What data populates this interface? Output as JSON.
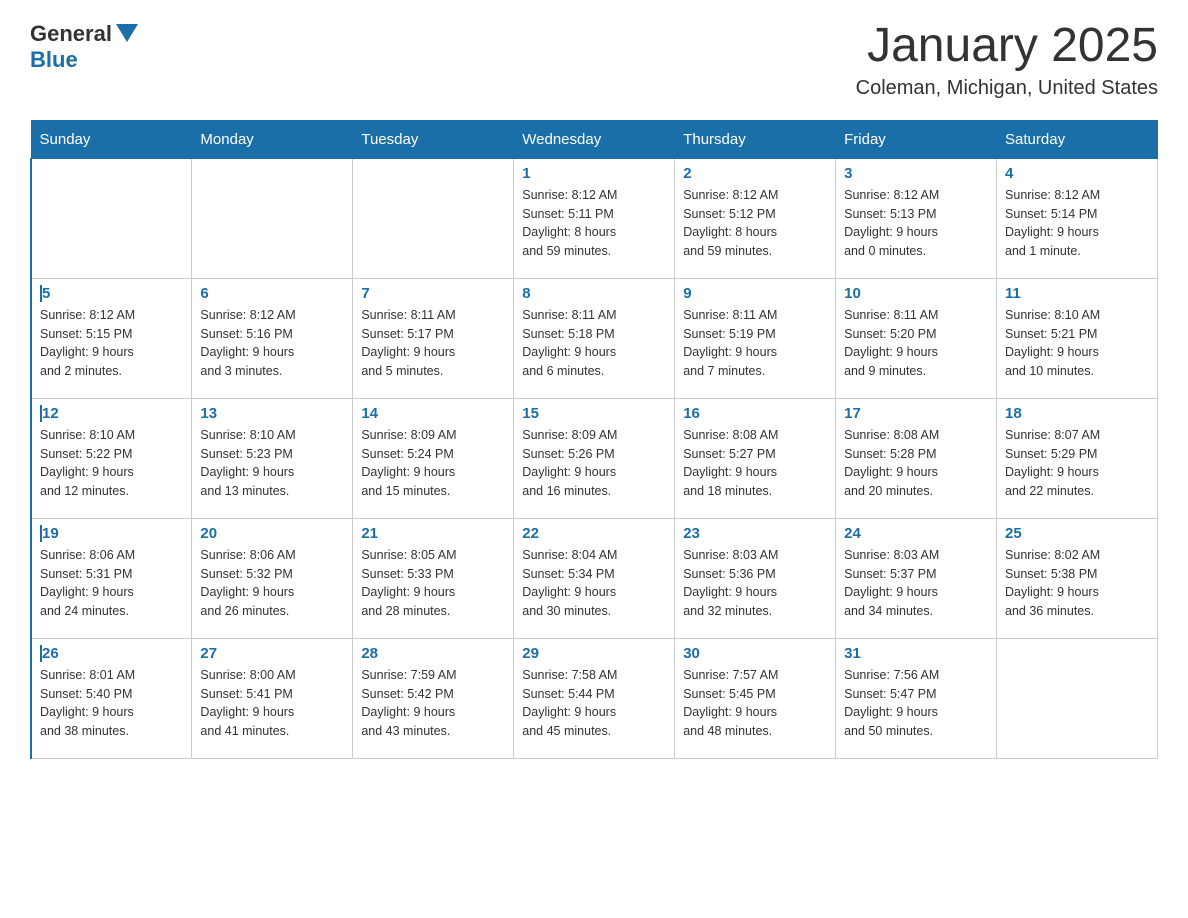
{
  "header": {
    "logo": {
      "general": "General",
      "arrow": "▶",
      "blue": "Blue"
    },
    "title": "January 2025",
    "location": "Coleman, Michigan, United States"
  },
  "weekdays": [
    "Sunday",
    "Monday",
    "Tuesday",
    "Wednesday",
    "Thursday",
    "Friday",
    "Saturday"
  ],
  "weeks": [
    [
      {
        "day": "",
        "info": ""
      },
      {
        "day": "",
        "info": ""
      },
      {
        "day": "",
        "info": ""
      },
      {
        "day": "1",
        "info": "Sunrise: 8:12 AM\nSunset: 5:11 PM\nDaylight: 8 hours\nand 59 minutes."
      },
      {
        "day": "2",
        "info": "Sunrise: 8:12 AM\nSunset: 5:12 PM\nDaylight: 8 hours\nand 59 minutes."
      },
      {
        "day": "3",
        "info": "Sunrise: 8:12 AM\nSunset: 5:13 PM\nDaylight: 9 hours\nand 0 minutes."
      },
      {
        "day": "4",
        "info": "Sunrise: 8:12 AM\nSunset: 5:14 PM\nDaylight: 9 hours\nand 1 minute."
      }
    ],
    [
      {
        "day": "5",
        "info": "Sunrise: 8:12 AM\nSunset: 5:15 PM\nDaylight: 9 hours\nand 2 minutes."
      },
      {
        "day": "6",
        "info": "Sunrise: 8:12 AM\nSunset: 5:16 PM\nDaylight: 9 hours\nand 3 minutes."
      },
      {
        "day": "7",
        "info": "Sunrise: 8:11 AM\nSunset: 5:17 PM\nDaylight: 9 hours\nand 5 minutes."
      },
      {
        "day": "8",
        "info": "Sunrise: 8:11 AM\nSunset: 5:18 PM\nDaylight: 9 hours\nand 6 minutes."
      },
      {
        "day": "9",
        "info": "Sunrise: 8:11 AM\nSunset: 5:19 PM\nDaylight: 9 hours\nand 7 minutes."
      },
      {
        "day": "10",
        "info": "Sunrise: 8:11 AM\nSunset: 5:20 PM\nDaylight: 9 hours\nand 9 minutes."
      },
      {
        "day": "11",
        "info": "Sunrise: 8:10 AM\nSunset: 5:21 PM\nDaylight: 9 hours\nand 10 minutes."
      }
    ],
    [
      {
        "day": "12",
        "info": "Sunrise: 8:10 AM\nSunset: 5:22 PM\nDaylight: 9 hours\nand 12 minutes."
      },
      {
        "day": "13",
        "info": "Sunrise: 8:10 AM\nSunset: 5:23 PM\nDaylight: 9 hours\nand 13 minutes."
      },
      {
        "day": "14",
        "info": "Sunrise: 8:09 AM\nSunset: 5:24 PM\nDaylight: 9 hours\nand 15 minutes."
      },
      {
        "day": "15",
        "info": "Sunrise: 8:09 AM\nSunset: 5:26 PM\nDaylight: 9 hours\nand 16 minutes."
      },
      {
        "day": "16",
        "info": "Sunrise: 8:08 AM\nSunset: 5:27 PM\nDaylight: 9 hours\nand 18 minutes."
      },
      {
        "day": "17",
        "info": "Sunrise: 8:08 AM\nSunset: 5:28 PM\nDaylight: 9 hours\nand 20 minutes."
      },
      {
        "day": "18",
        "info": "Sunrise: 8:07 AM\nSunset: 5:29 PM\nDaylight: 9 hours\nand 22 minutes."
      }
    ],
    [
      {
        "day": "19",
        "info": "Sunrise: 8:06 AM\nSunset: 5:31 PM\nDaylight: 9 hours\nand 24 minutes."
      },
      {
        "day": "20",
        "info": "Sunrise: 8:06 AM\nSunset: 5:32 PM\nDaylight: 9 hours\nand 26 minutes."
      },
      {
        "day": "21",
        "info": "Sunrise: 8:05 AM\nSunset: 5:33 PM\nDaylight: 9 hours\nand 28 minutes."
      },
      {
        "day": "22",
        "info": "Sunrise: 8:04 AM\nSunset: 5:34 PM\nDaylight: 9 hours\nand 30 minutes."
      },
      {
        "day": "23",
        "info": "Sunrise: 8:03 AM\nSunset: 5:36 PM\nDaylight: 9 hours\nand 32 minutes."
      },
      {
        "day": "24",
        "info": "Sunrise: 8:03 AM\nSunset: 5:37 PM\nDaylight: 9 hours\nand 34 minutes."
      },
      {
        "day": "25",
        "info": "Sunrise: 8:02 AM\nSunset: 5:38 PM\nDaylight: 9 hours\nand 36 minutes."
      }
    ],
    [
      {
        "day": "26",
        "info": "Sunrise: 8:01 AM\nSunset: 5:40 PM\nDaylight: 9 hours\nand 38 minutes."
      },
      {
        "day": "27",
        "info": "Sunrise: 8:00 AM\nSunset: 5:41 PM\nDaylight: 9 hours\nand 41 minutes."
      },
      {
        "day": "28",
        "info": "Sunrise: 7:59 AM\nSunset: 5:42 PM\nDaylight: 9 hours\nand 43 minutes."
      },
      {
        "day": "29",
        "info": "Sunrise: 7:58 AM\nSunset: 5:44 PM\nDaylight: 9 hours\nand 45 minutes."
      },
      {
        "day": "30",
        "info": "Sunrise: 7:57 AM\nSunset: 5:45 PM\nDaylight: 9 hours\nand 48 minutes."
      },
      {
        "day": "31",
        "info": "Sunrise: 7:56 AM\nSunset: 5:47 PM\nDaylight: 9 hours\nand 50 minutes."
      },
      {
        "day": "",
        "info": ""
      }
    ]
  ]
}
